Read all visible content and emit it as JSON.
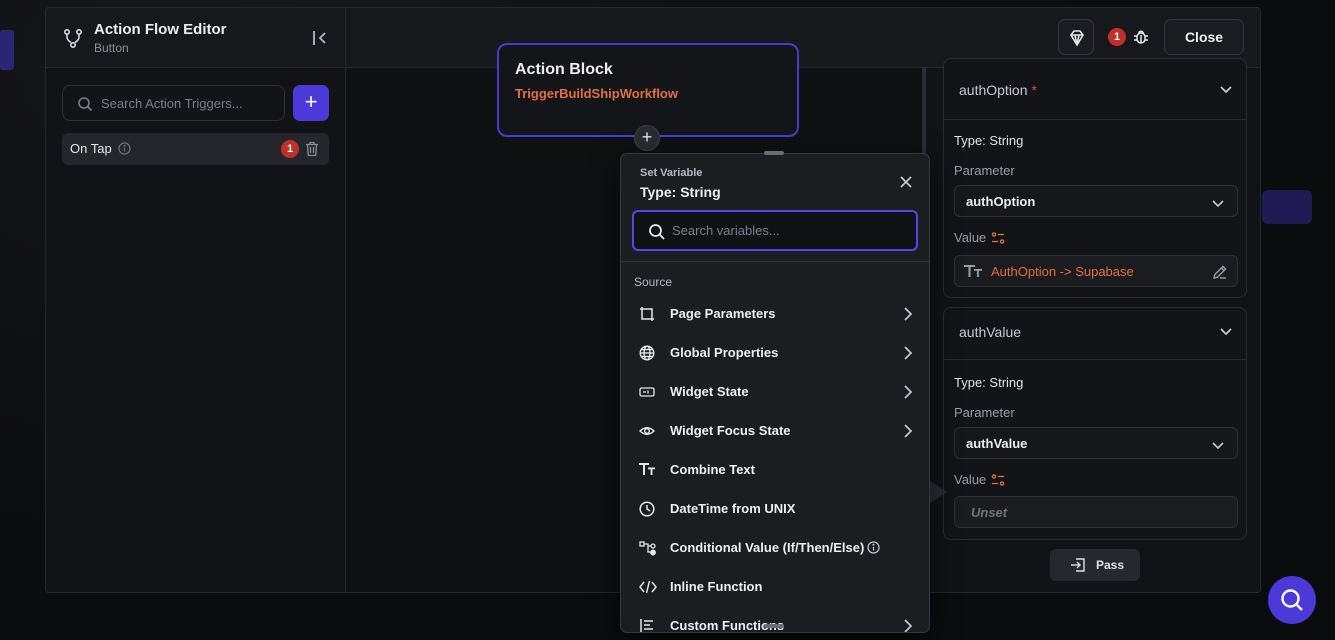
{
  "header": {
    "title": "Action Flow Editor",
    "subtitle": "Button",
    "debug_count": "1",
    "close_label": "Close"
  },
  "left_panel": {
    "search_placeholder": "Search Action Triggers...",
    "add_label": "+",
    "triggers": [
      {
        "label": "On Tap",
        "badge": "1"
      }
    ]
  },
  "canvas": {
    "action_block": {
      "title": "Action Block",
      "name": "TriggerBuildShipWorkflow"
    },
    "add_node_label": "+"
  },
  "popover": {
    "title": "Set Variable",
    "type": "Type: String",
    "search_placeholder": "Search variables...",
    "section_label": "Source",
    "items": [
      {
        "label": "Page Parameters",
        "icon": "page-params-icon",
        "has_submenu": true
      },
      {
        "label": "Global Properties",
        "icon": "globe-icon",
        "has_submenu": true
      },
      {
        "label": "Widget State",
        "icon": "widget-state-icon",
        "has_submenu": true
      },
      {
        "label": "Widget Focus State",
        "icon": "eye-icon",
        "has_submenu": true
      },
      {
        "label": "Combine Text",
        "icon": "text-icon",
        "has_submenu": false
      },
      {
        "label": "DateTime from UNIX",
        "icon": "clock-icon",
        "has_submenu": false
      },
      {
        "label": "Conditional Value (If/Then/Else)",
        "icon": "conditional-icon",
        "has_submenu": false
      },
      {
        "label": "Inline Function",
        "icon": "code-icon",
        "has_submenu": false
      },
      {
        "label": "Custom Functions",
        "icon": "custom-functions-icon",
        "has_submenu": true
      }
    ]
  },
  "right_panel": {
    "params": [
      {
        "name": "authOption",
        "required_mark": "*",
        "type": "Type: String",
        "parameter_label": "Parameter",
        "parameter_value": "authOption",
        "value_label": "Value",
        "value": "AuthOption -> Supabase"
      },
      {
        "name": "authValue",
        "type": "Type: String",
        "parameter_label": "Parameter",
        "parameter_value": "authValue",
        "value_label": "Value",
        "value": "Unset"
      }
    ],
    "pass_label": "Pass"
  },
  "colors": {
    "accent": "#4b39d8",
    "orange": "#e0713e",
    "badge": "#c0302b"
  }
}
